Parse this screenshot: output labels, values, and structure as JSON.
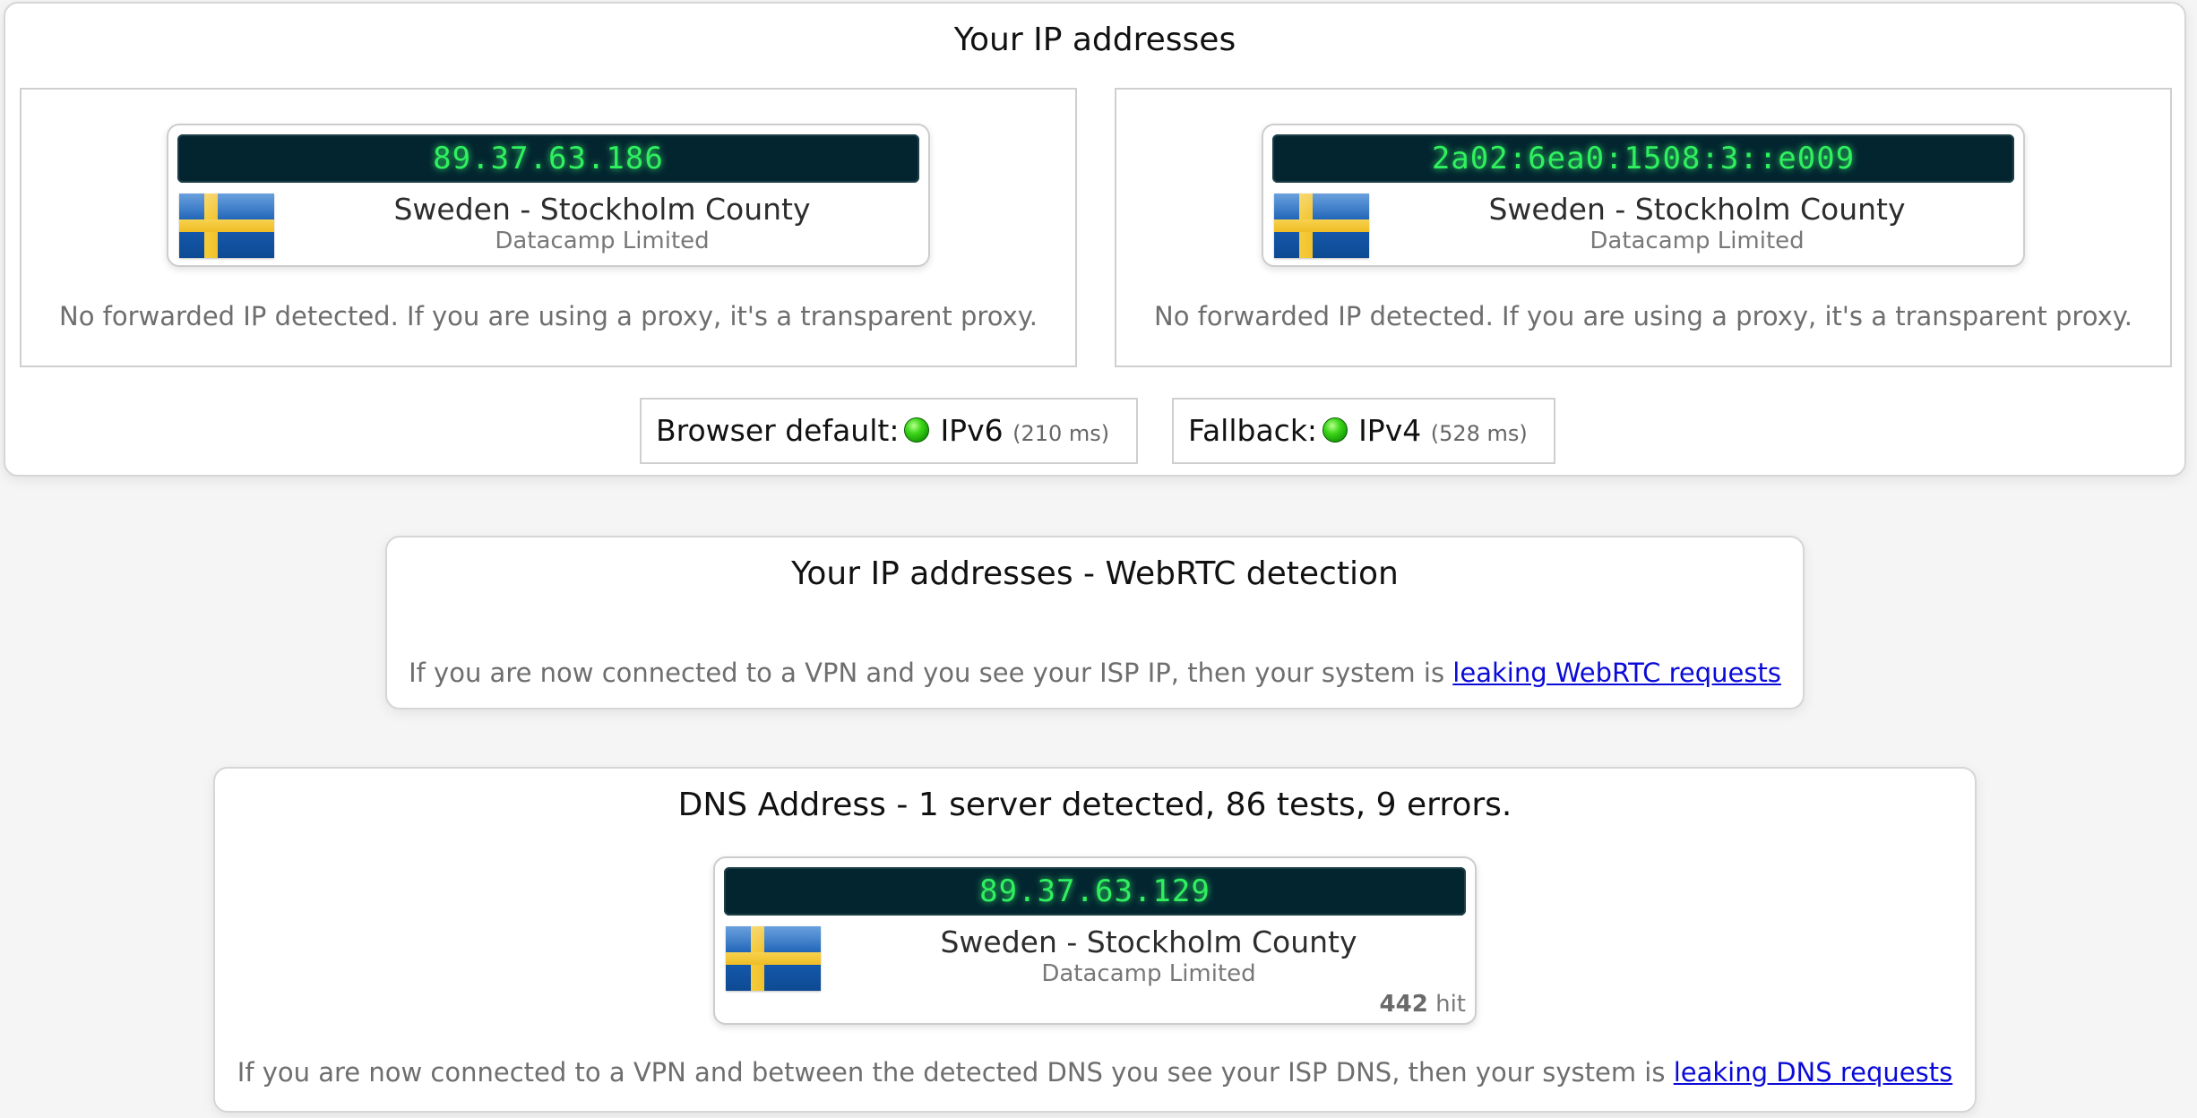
{
  "ip_section": {
    "title": "Your IP addresses",
    "ipv4": {
      "address": "89.37.63.186",
      "location": "Sweden - Stockholm County",
      "isp": "Datacamp Limited",
      "note": "No forwarded IP detected. If you are using a proxy, it's a transparent proxy."
    },
    "ipv6": {
      "address": "2a02:6ea0:1508:3::e009",
      "location": "Sweden - Stockholm County",
      "isp": "Datacamp Limited",
      "note": "No forwarded IP detected. If you are using a proxy, it's a transparent proxy."
    },
    "browser_default": {
      "label": "Browser default:",
      "protocol": "IPv6",
      "latency": "(210 ms)"
    },
    "fallback": {
      "label": "Fallback:",
      "protocol": "IPv4",
      "latency": "(528 ms)"
    }
  },
  "webrtc_section": {
    "title": "Your IP addresses - WebRTC detection",
    "note": "If you are now connected to a VPN and you see your ISP IP, then your system is",
    "link": "leaking WebRTC requests"
  },
  "dns_section": {
    "title": "DNS Address - 1 server detected, 86 tests, 9 errors.",
    "server": {
      "address": "89.37.63.129",
      "location": "Sweden - Stockholm County",
      "isp": "Datacamp Limited",
      "hits": "442",
      "hits_label": "hit"
    },
    "note": "If you are now connected to a VPN and between the detected DNS you see your ISP DNS, then your system is",
    "link": "leaking DNS requests"
  },
  "colors": {
    "display_bg": "#032530",
    "display_text": "#2ff05f",
    "link": "#0b0bd8",
    "status_green": "#3fd81c"
  }
}
